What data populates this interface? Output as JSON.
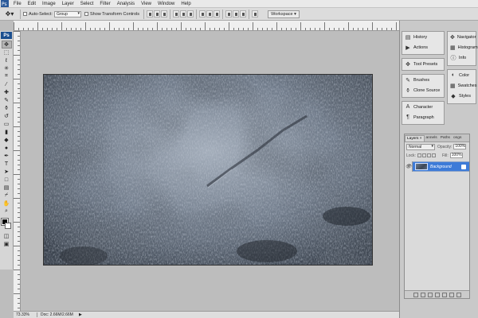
{
  "menubar": {
    "items": [
      "File",
      "Edit",
      "Image",
      "Layer",
      "Select",
      "Filter",
      "Analysis",
      "View",
      "Window",
      "Help"
    ]
  },
  "options": {
    "auto_select_label": "Auto-Select:",
    "auto_select_value": "Group",
    "transform_label": "Show Transform Controls",
    "workspace_label": "Workspace ▾"
  },
  "toolbox": {
    "logo": "Ps",
    "tools": [
      {
        "name": "move-tool",
        "glyph": "✥"
      },
      {
        "name": "marquee-tool",
        "glyph": "⬚"
      },
      {
        "name": "lasso-tool",
        "glyph": "ℓ"
      },
      {
        "name": "magic-wand-tool",
        "glyph": "✳"
      },
      {
        "name": "crop-tool",
        "glyph": "⌗"
      },
      {
        "name": "slice-tool",
        "glyph": "⁄"
      },
      {
        "name": "healing-brush-tool",
        "glyph": "✚"
      },
      {
        "name": "brush-tool",
        "glyph": "✎"
      },
      {
        "name": "clone-stamp-tool",
        "glyph": "⚱"
      },
      {
        "name": "history-brush-tool",
        "glyph": "↺"
      },
      {
        "name": "eraser-tool",
        "glyph": "▭"
      },
      {
        "name": "gradient-tool",
        "glyph": "▮"
      },
      {
        "name": "blur-tool",
        "glyph": "◆"
      },
      {
        "name": "dodge-tool",
        "glyph": "●"
      },
      {
        "name": "pen-tool",
        "glyph": "✒"
      },
      {
        "name": "type-tool",
        "glyph": "T"
      },
      {
        "name": "path-selection-tool",
        "glyph": "➤"
      },
      {
        "name": "shape-tool",
        "glyph": "□"
      },
      {
        "name": "notes-tool",
        "glyph": "▤"
      },
      {
        "name": "eyedropper-tool",
        "glyph": "⌿"
      },
      {
        "name": "hand-tool",
        "glyph": "✋"
      },
      {
        "name": "zoom-tool",
        "glyph": "⌕"
      }
    ]
  },
  "status": {
    "zoom": "73.33%",
    "doc": "Doc: 2.66M/2.66M",
    "arrow": "▶"
  },
  "dock_a": [
    {
      "label": "History",
      "icon": "history-icon",
      "glyph": "▤"
    },
    {
      "label": "Actions",
      "icon": "actions-icon",
      "glyph": "▶"
    },
    {
      "label": "Tool Presets",
      "icon": "tool-presets-icon",
      "glyph": "✥"
    },
    {
      "label": "Brushes",
      "icon": "brushes-icon",
      "glyph": "✎"
    },
    {
      "label": "Clone Source",
      "icon": "clone-source-icon",
      "glyph": "⚱"
    },
    {
      "label": "Character",
      "icon": "character-icon",
      "glyph": "A"
    },
    {
      "label": "Paragraph",
      "icon": "paragraph-icon",
      "glyph": "¶"
    }
  ],
  "dock_b": [
    {
      "label": "Navigator",
      "icon": "navigator-icon",
      "glyph": "✥"
    },
    {
      "label": "Histogram",
      "icon": "histogram-icon",
      "glyph": "▦"
    },
    {
      "label": "Info",
      "icon": "info-icon",
      "glyph": "ⓘ"
    },
    {
      "label": "Color",
      "icon": "color-icon",
      "glyph": "◐"
    },
    {
      "label": "Swatches",
      "icon": "swatches-icon",
      "glyph": "▦"
    },
    {
      "label": "Styles",
      "icon": "styles-icon",
      "glyph": "◆"
    }
  ],
  "layers": {
    "tabs": [
      "Layers ×",
      "annels",
      "Paths",
      "ongs"
    ],
    "blend_mode": "Normal",
    "opacity_label": "Opacity:",
    "opacity_value": "100%",
    "lock_label": "Lock:",
    "fill_label": "Fill:",
    "fill_value": "100%",
    "layer_name": "Background"
  },
  "colors": {
    "accent": "#3d7bd8",
    "fg": "#000000",
    "bg": "#ffffff"
  }
}
